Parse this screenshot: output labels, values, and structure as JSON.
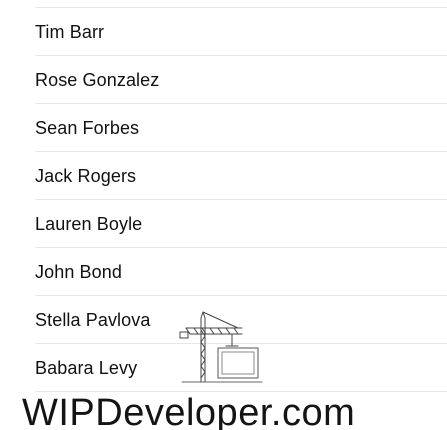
{
  "contacts": [
    "Tim Barr",
    "Rose Gonzalez",
    "Sean Forbes",
    "Jack Rogers",
    "Lauren Boyle",
    "John Bond",
    "Stella Pavlova",
    "Babara Levy"
  ],
  "watermark": {
    "text": "WIPDeveloper.com"
  },
  "icons": {
    "construction": "construction-crane-icon"
  },
  "colors": {
    "text": "#111111",
    "separator": "#e6e6e6",
    "background": "#ffffff"
  }
}
